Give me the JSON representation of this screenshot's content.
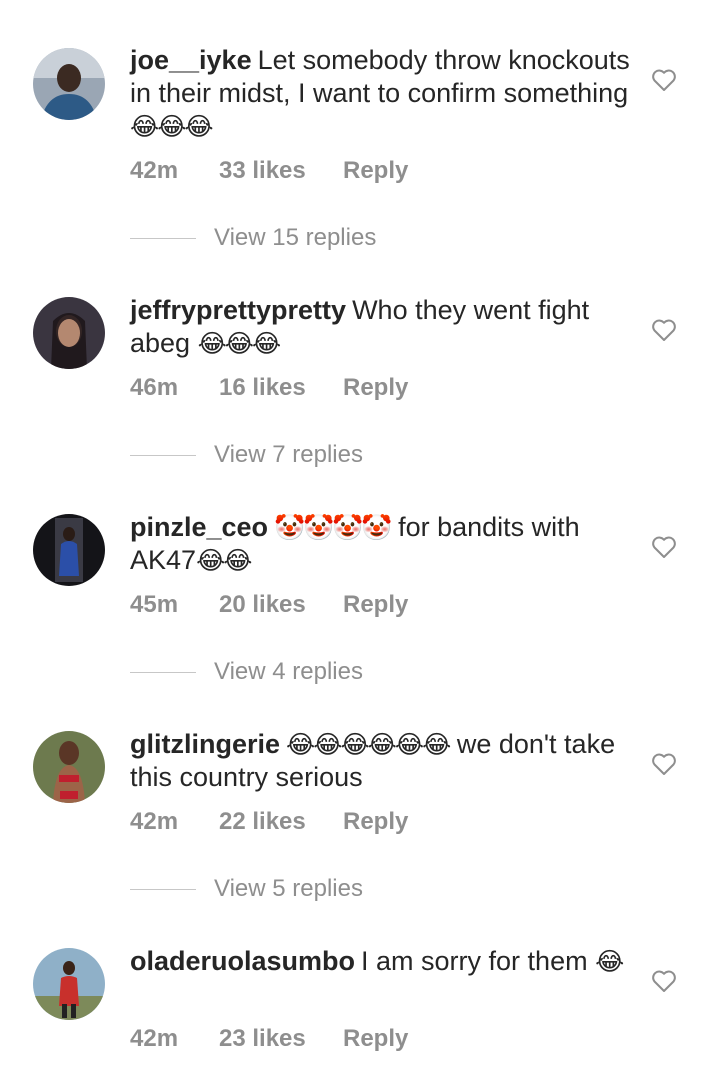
{
  "comments": [
    {
      "username": "joe__iyke",
      "text": "Let somebody throw knockouts in their midst, I want to confirm something",
      "emoji": "😂😂😂",
      "time": "42m",
      "likes": "33 likes",
      "reply": "Reply",
      "view_replies": "View 15 replies"
    },
    {
      "username": "jeffryprettypretty",
      "text": "Who they went fight abeg",
      "emoji": "😂😂😂",
      "time": "46m",
      "likes": "16 likes",
      "reply": "Reply",
      "view_replies": "View 7 replies"
    },
    {
      "username": "pinzle_ceo",
      "emoji_lead": "🤡🤡🤡🤡",
      "text": "for bandits with AK47",
      "emoji": "😂😂",
      "time": "45m",
      "likes": "20 likes",
      "reply": "Reply",
      "view_replies": "View 4 replies"
    },
    {
      "username": "glitzlingerie",
      "emoji_lead": "😂😂😂😂😂😂",
      "text": "we don't take this country serious",
      "time": "42m",
      "likes": "22 likes",
      "reply": "Reply",
      "view_replies": "View 5 replies"
    },
    {
      "username": "oladeruolasumbo",
      "text": "I am sorry for them",
      "emoji": "😂",
      "time": "42m",
      "likes": "23 likes",
      "reply": "Reply"
    }
  ]
}
